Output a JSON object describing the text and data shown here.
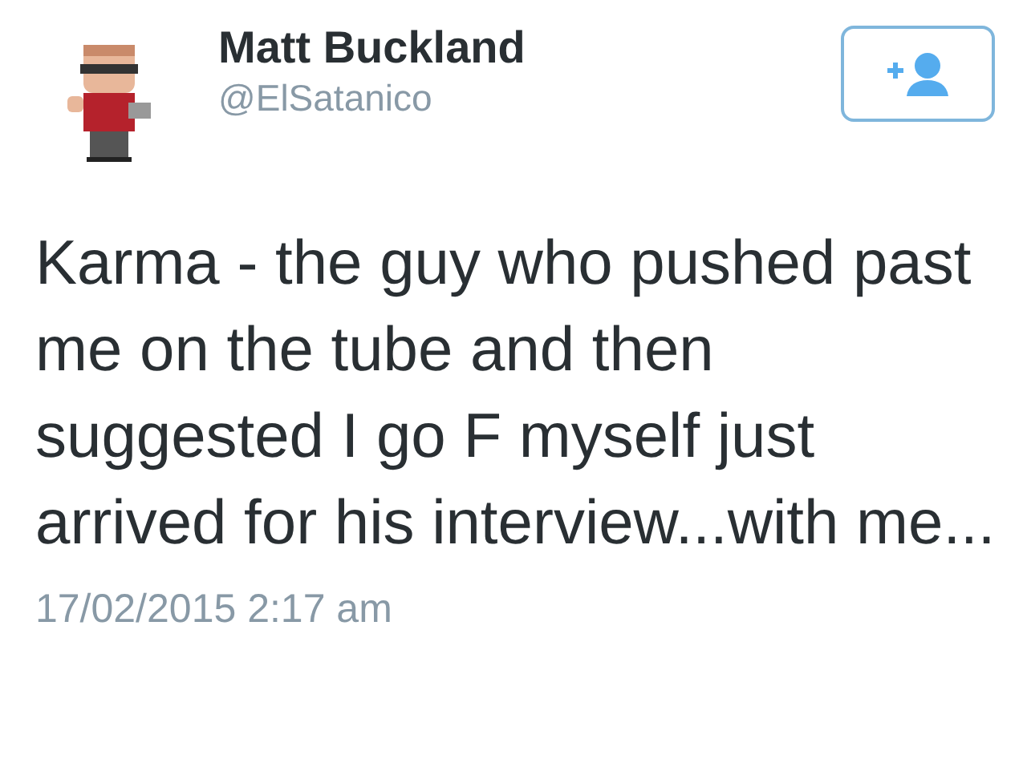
{
  "author": {
    "name": "Matt Buckland",
    "handle": "@ElSatanico"
  },
  "follow_button": {
    "following": false
  },
  "tweet": {
    "text": "Karma - the guy who pushed past me on the tube and then suggested I go F myself just arrived for his interview...with me...",
    "timestamp": "17/02/2015 2:17 am"
  }
}
